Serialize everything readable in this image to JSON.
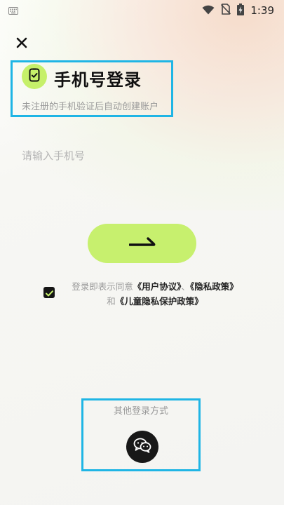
{
  "status_bar": {
    "time": "1:39",
    "icons": [
      "keyboard-icon",
      "wifi-icon",
      "no-sim-icon",
      "battery-charging-icon"
    ]
  },
  "header": {
    "title": "手机号登录",
    "subtitle": "未注册的手机验证后自动创建账户"
  },
  "phone": {
    "placeholder": "请输入手机号",
    "value": ""
  },
  "agreement": {
    "checked": true,
    "prefix": "登录即表示同意",
    "user_agreement": "《用户协议》",
    "separator": "、",
    "privacy_policy": "《隐私政策》",
    "and": "和",
    "child_privacy_policy": "《儿童隐私保护政策》"
  },
  "other_login": {
    "label": "其他登录方式",
    "icon": "wechat-icon"
  },
  "colors": {
    "accent": "#c7f06e",
    "highlight_border": "#1fb5e5",
    "dark": "#181818"
  }
}
